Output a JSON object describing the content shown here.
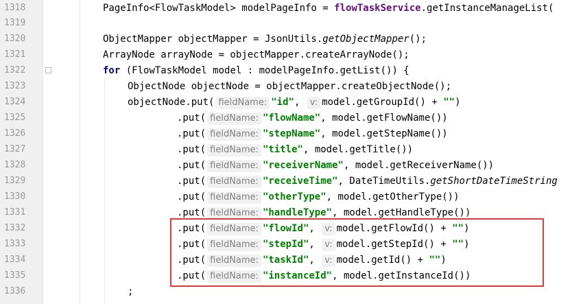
{
  "line_numbers": [
    "1318",
    "1319",
    "1320",
    "1321",
    "1322",
    "1323",
    "1324",
    "1325",
    "1326",
    "1327",
    "1328",
    "1329",
    "1330",
    "1331",
    "1332",
    "1333",
    "1334",
    "1335",
    "1336"
  ],
  "hints": {
    "field_name": "fieldName:",
    "v": "v:"
  },
  "code": {
    "l1318_a": "PageInfo<FlowTaskModel> modelPageInfo = ",
    "l1318_b": "flowTaskService",
    "l1318_c": ".getInstanceManageList(",
    "l1320_a": "ObjectMapper objectMapper = JsonUtils.",
    "l1320_b": "getObjectMapper",
    "l1320_c": "();",
    "l1321": "ArrayNode arrayNode = objectMapper.createArrayNode();",
    "l1322_kw": "for",
    "l1322_rest": " (FlowTaskModel model : modelPageInfo.getList()) {",
    "l1323": "ObjectNode objectNode = objectMapper.createObjectNode();",
    "l1324_a": "objectNode.put(",
    "l1324_str": "\"id\"",
    "l1324_c": ", ",
    "l1324_d": "model.getGroupId() + ",
    "l1324_e": "\"\"",
    "l1324_f": ")",
    "put": ".put(",
    "l1325_str": "\"flowName\"",
    "l1325_rest": ", model.getFlowName())",
    "l1326_str": "\"stepName\"",
    "l1326_rest": ", model.getStepName())",
    "l1327_str": "\"title\"",
    "l1327_rest": ", model.getTitle())",
    "l1328_str": "\"receiverName\"",
    "l1328_rest": ", model.getReceiverName())",
    "l1329_str": "\"receiveTime\"",
    "l1329_a": ", DateTimeUtils.",
    "l1329_b": "getShortDateTimeString",
    "l1330_str": "\"otherType\"",
    "l1330_rest": ", model.getOtherType())",
    "l1331_str": "\"handleType\"",
    "l1331_rest": ", model.getHandleType())",
    "l1332_str": "\"flowId\"",
    "l1332_c": ", ",
    "l1332_d": "model.getFlowId() + ",
    "l1332_e": "\"\"",
    "l1332_f": ")",
    "l1333_str": "\"stepId\"",
    "l1333_c": ", ",
    "l1333_d": "model.getStepId() + ",
    "l1333_e": "\"\"",
    "l1333_f": ")",
    "l1334_str": "\"taskId\"",
    "l1334_c": ", ",
    "l1334_d": "model.getId() + ",
    "l1334_e": "\"\"",
    "l1334_f": ")",
    "l1335_str": "\"instanceId\"",
    "l1335_rest": ", model.getInstanceId())",
    "l1336": ";"
  },
  "colors": {
    "highlight_box": "#e03b3b",
    "keyword": "#000080",
    "string": "#008000",
    "service_field": "#660e7a"
  }
}
